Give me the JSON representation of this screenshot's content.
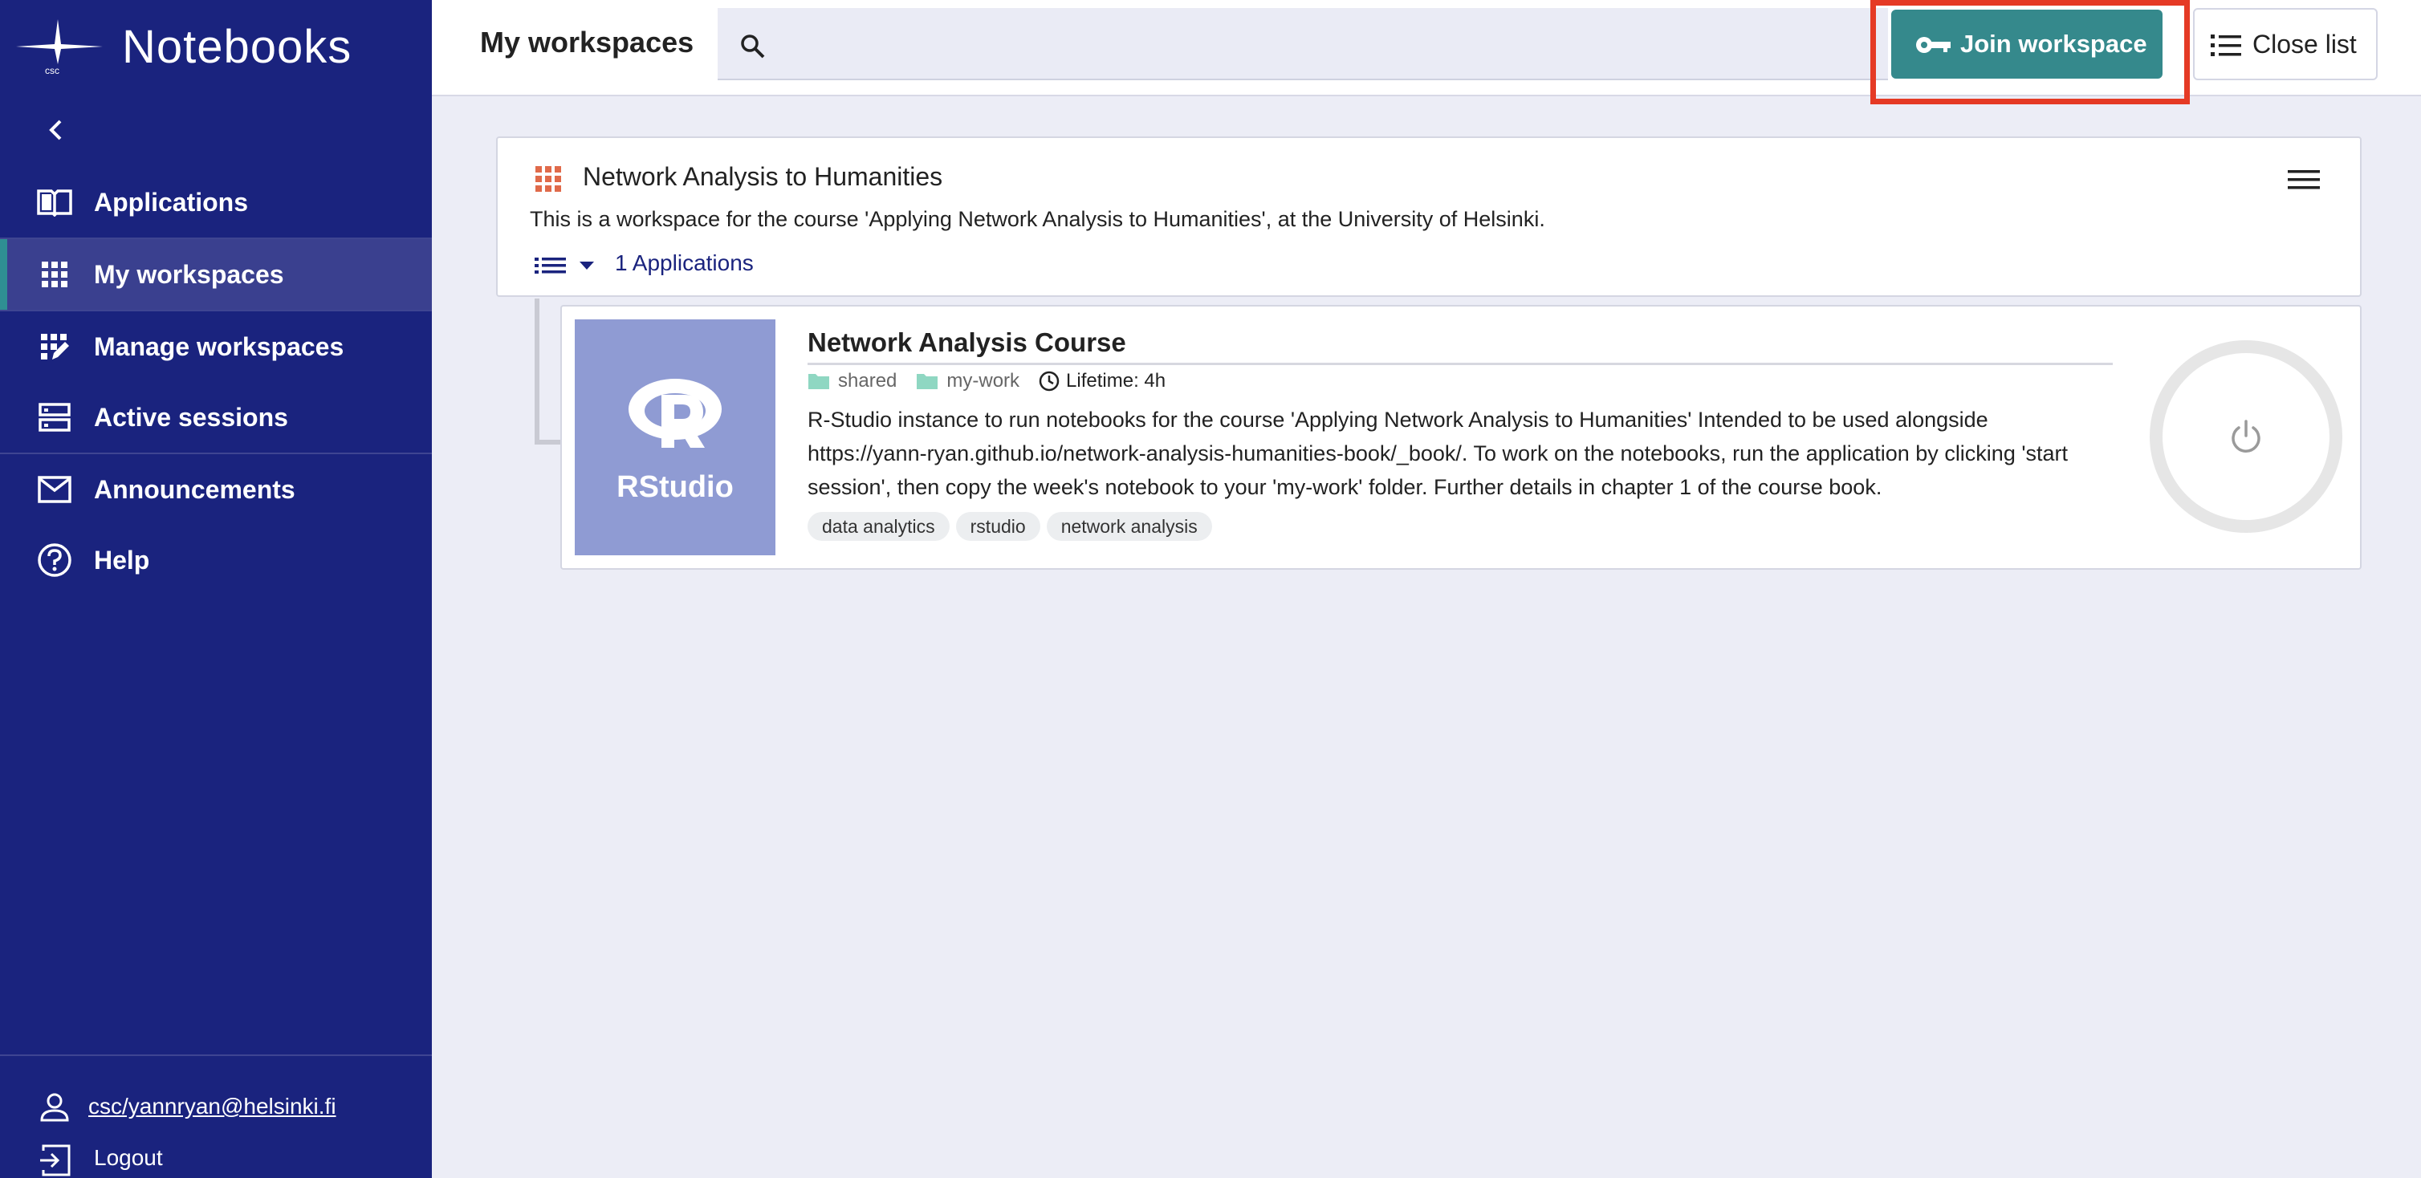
{
  "colors": {
    "sidebar_bg": "#1a237e",
    "active_item_bg": "#3a408f",
    "accent_teal": "#35898c",
    "highlight_red": "#e53a25",
    "rstudio_tile": "#8f9bd3",
    "workspace_icon": "#e06a4a"
  },
  "brand": {
    "name": "Notebooks",
    "logo_text": "csc",
    "logo_icon": "csc-star-logo"
  },
  "sidebar": {
    "collapse_icon": "chevron-left-icon",
    "items": [
      {
        "label": "Applications",
        "icon": "book-icon",
        "active": false
      },
      {
        "label": "My workspaces",
        "icon": "grid-icon",
        "active": true
      },
      {
        "label": "Manage workspaces",
        "icon": "grid-edit-icon",
        "active": false
      },
      {
        "label": "Active sessions",
        "icon": "server-icon",
        "active": false
      },
      {
        "label": "Announcements",
        "icon": "mail-icon",
        "active": false
      },
      {
        "label": "Help",
        "icon": "help-circle-icon",
        "active": false
      }
    ],
    "user": "csc/yannryan@helsinki.fi",
    "logout": "Logout"
  },
  "topbar": {
    "title": "My workspaces",
    "search_placeholder": "",
    "join_label": "Join workspace",
    "close_list_label": "Close list"
  },
  "workspace": {
    "title": "Network Analysis to Humanities",
    "description": "This is a workspace for the course 'Applying Network Analysis to Humanities', at the University of Helsinki.",
    "app_count": "1 Applications"
  },
  "application": {
    "thumbnail_label": "RStudio",
    "title": "Network Analysis Course",
    "meta": {
      "folder1": "shared",
      "folder2": "my-work",
      "lifetime": "Lifetime: 4h"
    },
    "description": "R-Studio instance to run notebooks for the course 'Applying Network Analysis to Humanities' Intended to be used alongside https://yann-ryan.github.io/network-analysis-humanities-book/_book/. To work on the notebooks, run the application by clicking 'start session', then copy the week's notebook to your 'my-work' folder. Further details in chapter 1 of the course book.",
    "tags": [
      "data analytics",
      "rstudio",
      "network analysis"
    ]
  }
}
